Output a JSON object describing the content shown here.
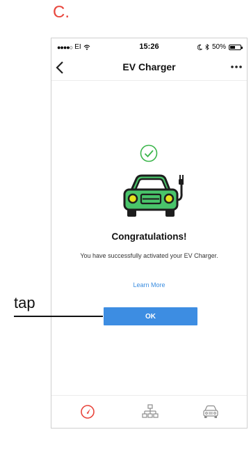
{
  "annotation": {
    "step_label": "C.",
    "tap_label": "tap"
  },
  "statusbar": {
    "carrier": "EI",
    "time": "15:26",
    "battery": "50%",
    "battery_level": 0.5
  },
  "navbar": {
    "title": "EV Charger"
  },
  "content": {
    "heading": "Congratulations!",
    "message": "You have successfully activated your EV Charger.",
    "learn_more": "Learn More",
    "ok_label": "OK"
  },
  "tabs": [
    {
      "icon": "speedometer-icon",
      "active": true
    },
    {
      "icon": "network-icon",
      "active": false
    },
    {
      "icon": "car-icon",
      "active": false
    }
  ],
  "colors": {
    "accent": "#3d8de2",
    "success_green": "#3ab54a",
    "car_green": "#49c46a",
    "headlight_yellow": "#e6e21e",
    "active_tab_red": "#e8453c",
    "annotation_red": "#e8453c"
  }
}
